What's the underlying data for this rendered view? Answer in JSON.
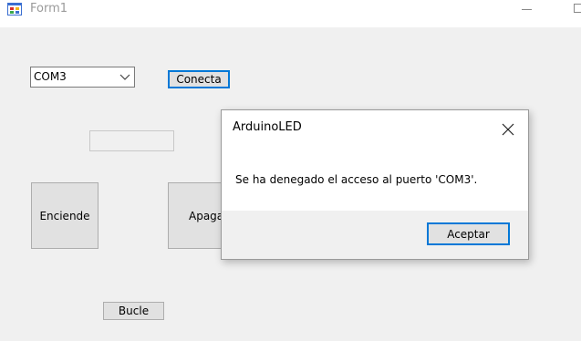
{
  "window": {
    "title": "Form1"
  },
  "form": {
    "port_select": {
      "selected": "COM3"
    },
    "connect_label": "Conecta",
    "on_label": "Enciende",
    "off_label": "Apaga",
    "loop_label": "Bucle",
    "status_text": ""
  },
  "dialog": {
    "title": "ArduinoLED",
    "message": "Se ha denegado el acceso al puerto 'COM3'.",
    "ok_label": "Aceptar"
  },
  "colors": {
    "focus_accent": "#0078d7",
    "button_face": "#e1e1e1",
    "form_background": "#f0f0f0"
  },
  "icons": {
    "app": "form-app-icon",
    "minimize": "minimize-icon",
    "maximize": "maximize-icon",
    "dropdown": "chevron-down-icon",
    "close": "close-icon"
  }
}
